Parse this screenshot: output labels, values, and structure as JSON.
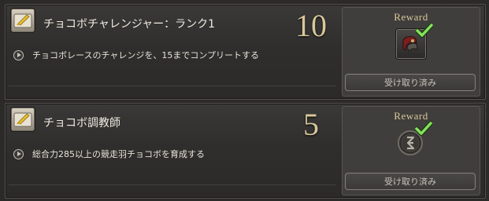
{
  "achievements": [
    {
      "title": "チョコボチャレンジャー：ランク1",
      "points": "10",
      "description": "チョコボレースのチャレンジを、15までコンプリートする",
      "reward_label": "Reward",
      "reward_icon": "chocobo-saddle-item-icon",
      "claimed_label": "受け取り済み"
    },
    {
      "title": "チョコボ調教師",
      "points": "5",
      "description": "総合力285以上の競走羽チョコボを育成する",
      "reward_label": "Reward",
      "reward_icon": "title-reward-icon",
      "claimed_label": "受け取り済み"
    }
  ],
  "colors": {
    "points_gold": "#d8c79a",
    "check_green": "#7fd85a"
  }
}
